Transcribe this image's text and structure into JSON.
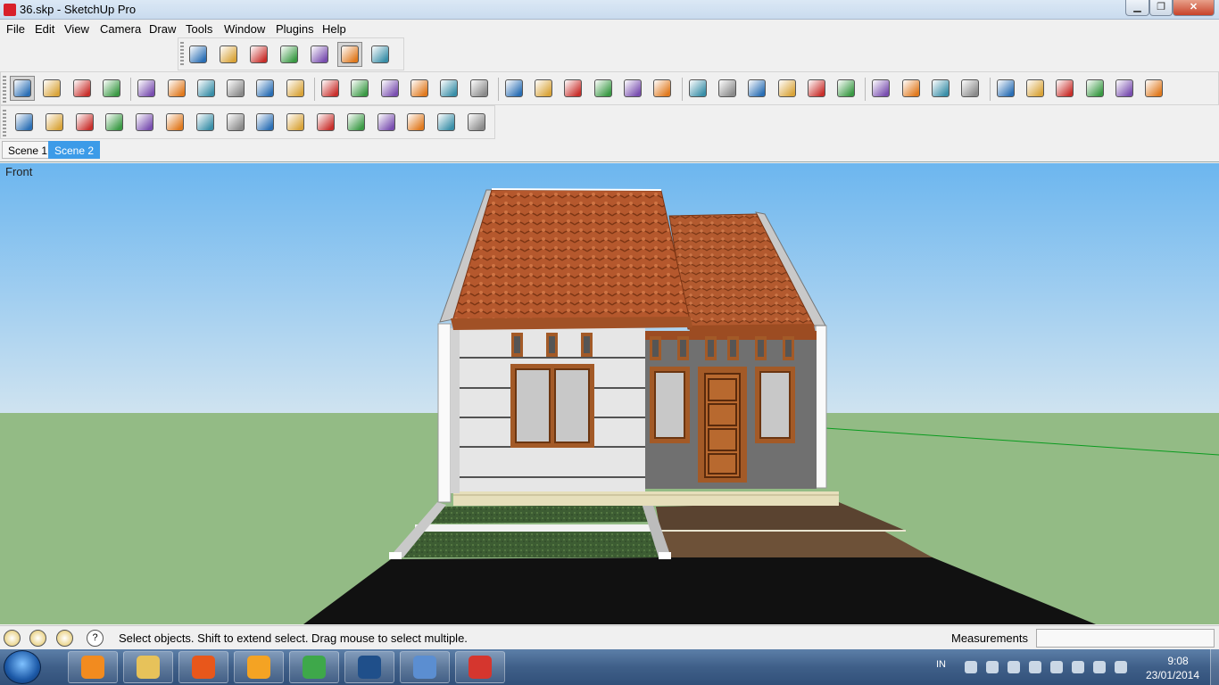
{
  "window": {
    "title": "36.skp - SketchUp Pro",
    "minimize_glyph": "▁",
    "maximize_glyph": "❐",
    "close_glyph": "✕"
  },
  "menu": {
    "items": [
      "File",
      "Edit",
      "View",
      "Camera",
      "Draw",
      "Tools",
      "Window",
      "Plugins",
      "Help"
    ]
  },
  "toolbars": {
    "styles": [
      "xray-icon",
      "back-edges-icon",
      "wireframe-icon",
      "hidden-line-icon",
      "shaded-icon",
      "shaded-textures-icon",
      "monochrome-icon"
    ],
    "main": [
      "select-icon",
      "component-icon",
      "paint-bucket-icon",
      "eraser-icon",
      "rectangle-icon",
      "line-icon",
      "circle-icon",
      "arc-icon",
      "polygon-icon",
      "freehand-icon",
      "move-icon",
      "push-pull-icon",
      "rotate-icon",
      "follow-me-icon",
      "scale-icon",
      "offset-icon",
      "tape-measure-icon",
      "dimension-icon",
      "protractor-icon",
      "text-icon",
      "axes-icon",
      "3d-text-icon",
      "orbit-icon",
      "pan-icon",
      "zoom-icon",
      "zoom-window-icon",
      "zoom-extents-icon",
      "previous-view-icon",
      "position-camera-icon",
      "look-around-icon",
      "walk-icon",
      "section-plane-icon",
      "iso-view-icon",
      "top-view-icon",
      "front-view-icon",
      "right-view-icon",
      "back-view-icon",
      "left-view-icon"
    ],
    "plugins": [
      "material-icon",
      "object-icon",
      "render-icon",
      "render-region-icon",
      "help-icon",
      "tag-icon",
      "omni-light-icon",
      "spot-light-icon",
      "area-light-icon",
      "sky-dome-icon",
      "sphere-light-icon",
      "ies-light-icon",
      "sphere-icon",
      "infinite-plane-icon",
      "tree-proxy-icon",
      "tree-export-icon"
    ],
    "selected_tool": "select-icon",
    "selected_style": "shaded-textures-icon"
  },
  "scenes": {
    "tabs": [
      "Scene 1",
      "Scene 2"
    ],
    "active": "Scene 2"
  },
  "viewport": {
    "view_label": "Front"
  },
  "colors": {
    "sky_top": "#6cb6ef",
    "sky_bottom": "#cfe3f0",
    "ground": "#93bb85",
    "roof": "#b5582d",
    "wall_light": "#e6e6e6",
    "wall_dark": "#707070",
    "wood": "#a35a27",
    "road": "#111111",
    "axis_green": "#0a9b1f",
    "scene_active": "#3c9be8"
  },
  "status": {
    "message": "Select objects. Shift to extend select. Drag mouse to select multiple.",
    "measurements_label": "Measurements",
    "measurements_value": ""
  },
  "taskbar": {
    "apps": [
      "media-player-icon",
      "file-explorer-icon",
      "firefox-icon",
      "ubuntu-icon",
      "chrome-icon",
      "photoshop-icon",
      "control-panel-icon",
      "sketchup-icon"
    ],
    "language": "IN",
    "time": "9:08",
    "date": "23/01/2014"
  }
}
